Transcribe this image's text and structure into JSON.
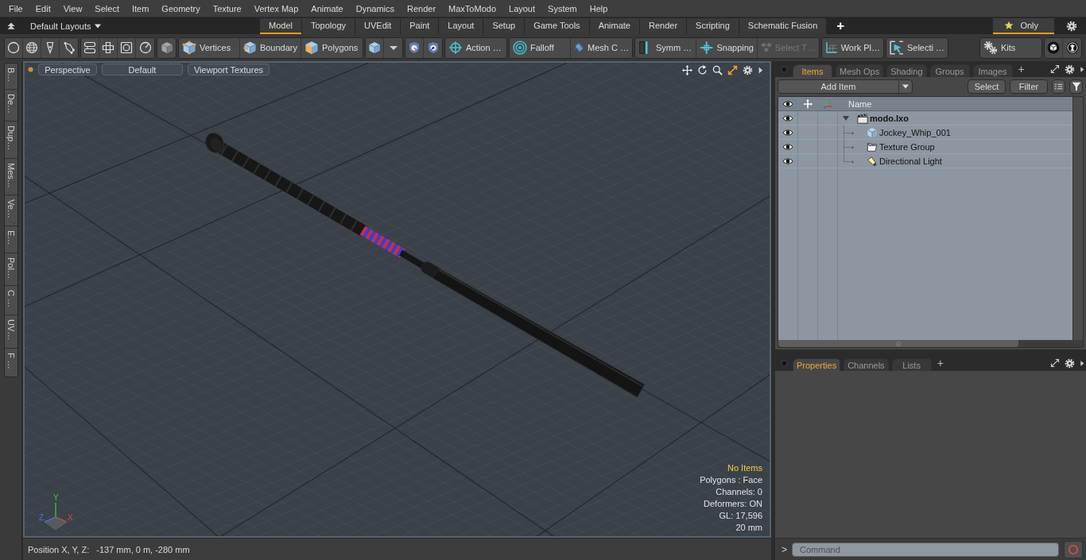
{
  "menu_bar": {
    "items": [
      "File",
      "Edit",
      "View",
      "Select",
      "Item",
      "Geometry",
      "Texture",
      "Vertex Map",
      "Animate",
      "Dynamics",
      "Render",
      "MaxToModo",
      "Layout",
      "System",
      "Help"
    ]
  },
  "layout_bar": {
    "layouts": "Default Layouts",
    "tabs": [
      {
        "label": "Model",
        "selected": true
      },
      {
        "label": "Topology",
        "selected": false
      },
      {
        "label": "UVEdit",
        "selected": false
      },
      {
        "label": "Paint",
        "selected": false
      },
      {
        "label": "Layout",
        "selected": false
      },
      {
        "label": "Setup",
        "selected": false
      },
      {
        "label": "Game Tools",
        "selected": false
      },
      {
        "label": "Animate",
        "selected": false
      },
      {
        "label": "Render",
        "selected": false
      },
      {
        "label": "Scripting",
        "selected": false
      },
      {
        "label": "Schematic Fusion",
        "selected": false
      }
    ],
    "add_tab": "+",
    "only": {
      "label": "Only",
      "on": true
    }
  },
  "toolbar": {
    "buttons": [
      {
        "label": "Vertices",
        "disabled": false
      },
      {
        "label": "Boundary",
        "disabled": false
      },
      {
        "label": "Polygons",
        "disabled": false
      },
      {
        "label": "Action …",
        "disabled": false
      },
      {
        "label": "Falloff",
        "disabled": false
      },
      {
        "label": "Mesh C …",
        "disabled": false
      },
      {
        "label": "Symm …",
        "disabled": false
      },
      {
        "label": "Snapping",
        "disabled": false
      },
      {
        "label": "Select T…",
        "disabled": true
      },
      {
        "label": "Work Pl…",
        "disabled": false
      },
      {
        "label": "Selecti …",
        "disabled": false
      },
      {
        "label": "Kits",
        "disabled": false
      }
    ]
  },
  "side_tabs": [
    "B…",
    "De…",
    "Dup…",
    "Mes…",
    "Ve…",
    "E…",
    "Pol…",
    "C …",
    "UV…",
    "F …"
  ],
  "viewport": {
    "buttons": [
      "Perspective",
      "Default",
      "Viewport Textures"
    ],
    "info": {
      "title": "No Items",
      "lines": [
        "Polygons : Face",
        "Channels: 0",
        "Deformers: ON",
        "GL: 17,596",
        "20 mm"
      ]
    },
    "axes": [
      "X",
      "Y",
      "Z"
    ]
  },
  "status_bar": {
    "label": "Position X, Y, Z:",
    "value": "-137 mm, 0 m, -280 mm"
  },
  "items_panel": {
    "tabs": [
      {
        "label": "Items",
        "selected": true
      },
      {
        "label": "Mesh Ops",
        "selected": false
      },
      {
        "label": "Shading",
        "selected": false
      },
      {
        "label": "Groups",
        "selected": false
      },
      {
        "label": "Images",
        "selected": false
      }
    ],
    "add_tab": "+",
    "add_item": "Add Item",
    "buttons": [
      "Select",
      "Filter"
    ],
    "tree": {
      "column": "Name",
      "rows": [
        {
          "name": "modo.lxo",
          "kind": "scene",
          "visible": true,
          "expanded": true,
          "children": [
            {
              "name": "Jockey_Whip_001",
              "kind": "mesh",
              "visible": true
            },
            {
              "name": "Texture Group",
              "kind": "group",
              "visible": true
            },
            {
              "name": "Directional Light",
              "kind": "light",
              "visible": true
            }
          ]
        }
      ]
    }
  },
  "properties_panel": {
    "tabs": [
      {
        "label": "Properties",
        "selected": true
      },
      {
        "label": "Channels",
        "selected": false
      },
      {
        "label": "Lists",
        "selected": false
      }
    ],
    "add_tab": "+"
  },
  "command_bar": {
    "prompt": ">",
    "placeholder": "Command"
  }
}
